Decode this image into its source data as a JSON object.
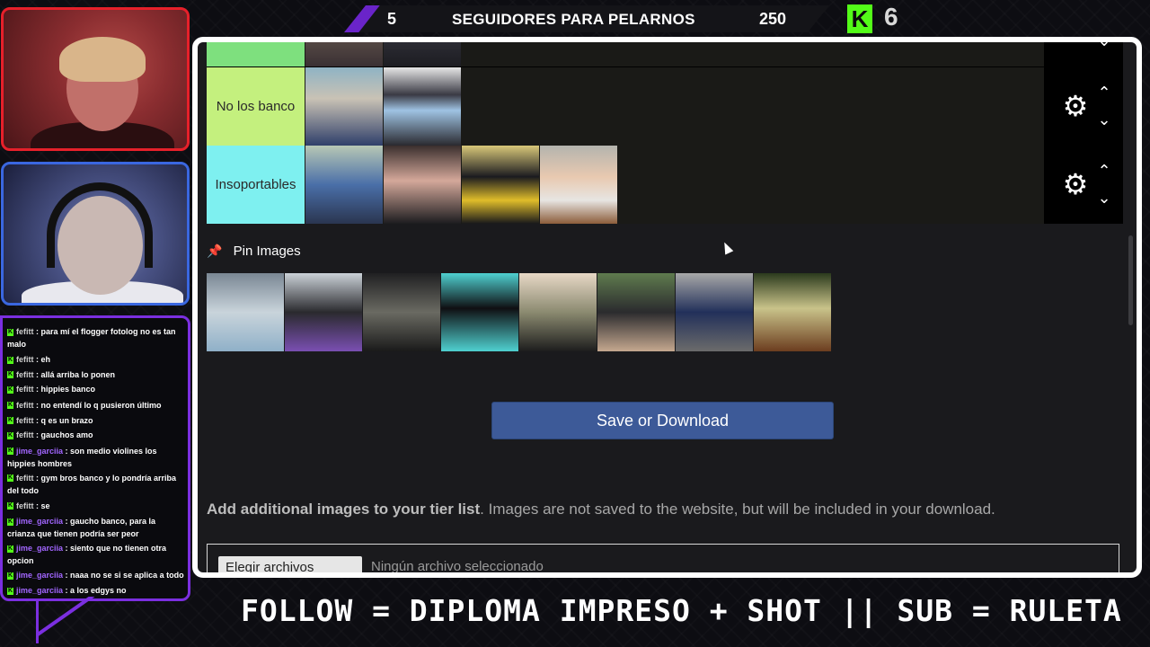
{
  "banner": {
    "left_count": "5",
    "title": "SEGUIDORES PARA PELARNOS",
    "right_count": "250",
    "kick_logo": "K",
    "kick_count": "6"
  },
  "chat": [
    {
      "user": "fefitt",
      "text": "para mí el flogger fotolog no es tan malo",
      "color": "u1"
    },
    {
      "user": "fefitt",
      "text": "eh",
      "color": "u1"
    },
    {
      "user": "fefitt",
      "text": "allá arriba lo ponen",
      "color": "u1"
    },
    {
      "user": "fefitt",
      "text": "hippies banco",
      "color": "u1"
    },
    {
      "user": "fefitt",
      "text": "no entendí lo q pusieron último",
      "color": "u1"
    },
    {
      "user": "fefitt",
      "text": "q es un brazo",
      "color": "u1"
    },
    {
      "user": "fefitt",
      "text": "gauchos amo",
      "color": "u1"
    },
    {
      "user": "jime_garciia",
      "text": "son medio violines los hippies hombres",
      "color": "u2"
    },
    {
      "user": "fefitt",
      "text": "gym bros banco y lo pondría arriba del todo",
      "color": "u1"
    },
    {
      "user": "fefitt",
      "text": "se",
      "color": "u1"
    },
    {
      "user": "jime_garciia",
      "text": "gaucho banco, para la crianza que tienen podría ser peor",
      "color": "u2"
    },
    {
      "user": "jime_garciia",
      "text": "siento que no tienen otra opcion",
      "color": "u2"
    },
    {
      "user": "jime_garciia",
      "text": "naaa no se si se aplica a todo",
      "color": "u2"
    },
    {
      "user": "jime_garciia",
      "text": "a los edgys no",
      "color": "u2"
    }
  ],
  "tiers": [
    {
      "label": "",
      "color": "#7ee07e"
    },
    {
      "label": "No los banco",
      "color": "#c4f07e"
    },
    {
      "label": "Insoportables",
      "color": "#7ef0f0"
    }
  ],
  "pin_label": "Pin Images",
  "save_button": "Save or Download",
  "add_images": {
    "bold": "Add additional images to your tier list",
    "rest": ". Images are not saved to the website, but will be included in your download."
  },
  "file_input": {
    "button": "Elegir archivos",
    "status": "Ningún archivo seleccionado"
  },
  "bottom_banner": "FOLLOW = DIPLOMA IMPRESO + SHOT   ||   SUB = RULETA",
  "icons": {
    "settings": "gear-icon",
    "up": "chevron-up-icon",
    "down": "chevron-down-icon",
    "pin": "pushpin-icon"
  }
}
